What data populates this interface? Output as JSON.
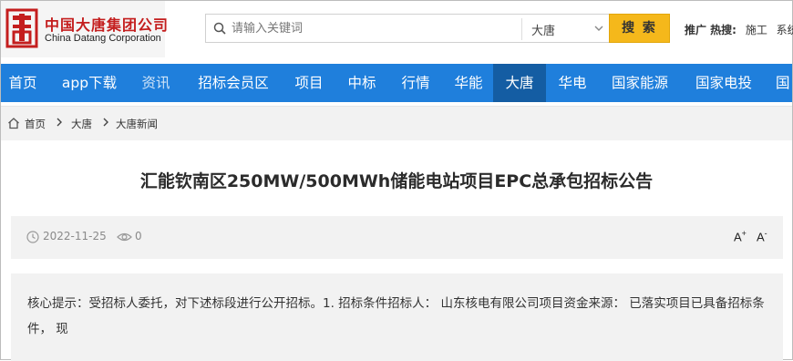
{
  "logo": {
    "cn": "中国大唐集团公司",
    "en": "China Datang Corporation",
    "mark": "datang-logo-mark"
  },
  "search": {
    "placeholder": "请输入关键词",
    "scope": "大唐",
    "button": "搜 索"
  },
  "hot": {
    "label": "推广 热搜:",
    "keywords": [
      "施工",
      "系统"
    ]
  },
  "nav": [
    {
      "label": "首页",
      "style": "active-home"
    },
    {
      "label": "app下载"
    },
    {
      "label": "资讯",
      "style": "dim"
    },
    {
      "label": "招标会员区"
    },
    {
      "label": "项目"
    },
    {
      "label": "中标"
    },
    {
      "label": "行情"
    },
    {
      "label": "华能"
    },
    {
      "label": "大唐",
      "style": "active"
    },
    {
      "label": "华电"
    },
    {
      "label": "国家能源"
    },
    {
      "label": "国家电投"
    },
    {
      "label": "国"
    }
  ],
  "breadcrumb": [
    "首页",
    "大唐",
    "大唐新闻"
  ],
  "article": {
    "title": "汇能钦南区250MW/500MWh储能电站项目EPC总承包招标公告",
    "date": "2022-11-25",
    "views": "0",
    "font_up": "A",
    "font_down": "A",
    "summary": "核心提示：受招标人委托，对下述标段进行公开招标。1.   招标条件招标人：  山东核电有限公司项目资金来源：  已落实项目已具备招标条件，  现"
  },
  "colors": {
    "nav_bg": "#1f7fdc",
    "nav_active": "#145da3",
    "button": "#f5b81b",
    "logo_red": "#c41e1e"
  }
}
